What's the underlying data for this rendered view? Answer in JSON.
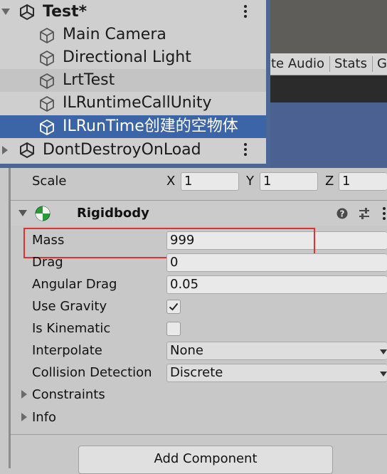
{
  "hierarchy": {
    "scene_name": "Test*",
    "objects": [
      {
        "label": "Main Camera",
        "icon": "cube-icon"
      },
      {
        "label": "Directional Light",
        "icon": "cube-icon"
      },
      {
        "label": "LrtTest",
        "icon": "cube-icon"
      },
      {
        "label": "ILRuntimeCallUnity",
        "icon": "cube-icon"
      },
      {
        "label": "ILRunTime创建的空物体",
        "icon": "cube-icon",
        "selected": true
      }
    ],
    "dont_destroy": "DontDestroyOnLoad",
    "selection_color": "#3c65a8"
  },
  "game_tabs": {
    "audio": "te Audio",
    "stats": "Stats",
    "gizmos": "G"
  },
  "transform": {
    "scale_label": "Scale",
    "x_label": "X",
    "x_value": "1",
    "y_label": "Y",
    "y_value": "1",
    "z_label": "Z",
    "z_value": "1"
  },
  "rigidbody": {
    "title": "Rigidbody",
    "mass_label": "Mass",
    "mass_value": "999",
    "drag_label": "Drag",
    "drag_value": "0",
    "angular_drag_label": "Angular Drag",
    "angular_drag_value": "0.05",
    "use_gravity_label": "Use Gravity",
    "use_gravity_checked": true,
    "is_kinematic_label": "Is Kinematic",
    "is_kinematic_checked": false,
    "interpolate_label": "Interpolate",
    "interpolate_value": "None",
    "collision_label": "Collision Detection",
    "collision_value": "Discrete",
    "constraints_label": "Constraints",
    "info_label": "Info",
    "highlight_color": "#e03030"
  },
  "add_component_label": "Add Component"
}
